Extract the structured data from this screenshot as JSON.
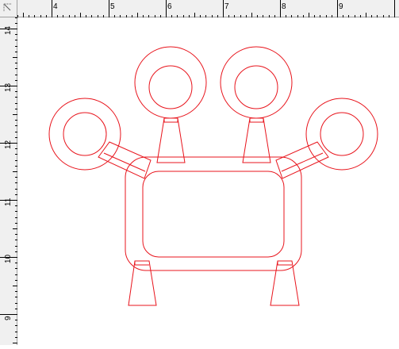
{
  "rulers": {
    "corner_icon": "ruler-origin-icon",
    "horizontal": {
      "labels": [
        "4",
        "5",
        "6",
        "7",
        "8",
        "9"
      ]
    },
    "vertical": {
      "labels": [
        "14",
        "13",
        "12",
        "11",
        "10",
        "9"
      ]
    }
  },
  "drawing": {
    "stroke_color": "#e8141c"
  }
}
